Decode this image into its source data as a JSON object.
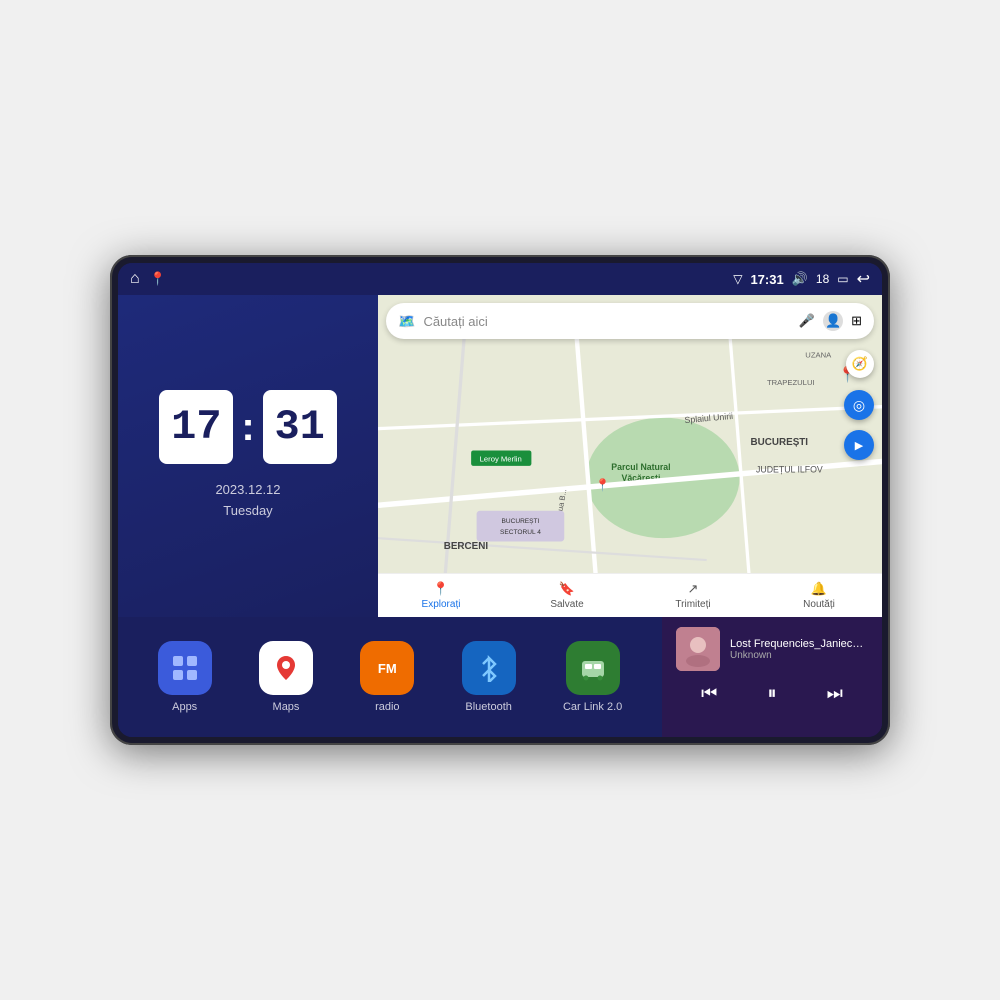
{
  "device": {
    "screen_bg": "#1a1f5e"
  },
  "status_bar": {
    "gps_icon": "▽",
    "time": "17:31",
    "volume_icon": "🔊",
    "battery_level": "18",
    "battery_icon": "▭",
    "back_icon": "↩"
  },
  "nav_icons": [
    {
      "name": "home",
      "symbol": "⌂"
    },
    {
      "name": "map-pin",
      "symbol": "📍"
    }
  ],
  "clock": {
    "hours": "17",
    "minutes": "31",
    "date": "2023.12.12",
    "day": "Tuesday"
  },
  "map": {
    "search_placeholder": "Căutați aici",
    "areas": [
      "BUCUREȘTI",
      "JUDEȚUL ILFOV",
      "BERCENI",
      "TRAPEZULUI",
      "UZANA"
    ],
    "places": [
      "Parcul Natural Văcărești",
      "Leroy Merlin",
      "BUCUREȘTI\nSECTORUL 4"
    ],
    "nav_items": [
      {
        "label": "Explorați",
        "icon": "📍",
        "active": true
      },
      {
        "label": "Salvate",
        "icon": "🔖",
        "active": false
      },
      {
        "label": "Trimiteți",
        "icon": "↗",
        "active": false
      },
      {
        "label": "Noutăți",
        "icon": "🔔",
        "active": false
      }
    ]
  },
  "apps": [
    {
      "name": "Apps",
      "icon": "apps",
      "bg": "#3b5bdb"
    },
    {
      "name": "Maps",
      "icon": "maps",
      "bg": "#e53935"
    },
    {
      "name": "radio",
      "icon": "radio",
      "bg": "#ef6c00"
    },
    {
      "name": "Bluetooth",
      "icon": "bluetooth",
      "bg": "#1565c0"
    },
    {
      "name": "Car Link 2.0",
      "icon": "carlink",
      "bg": "#2e7d32"
    }
  ],
  "music": {
    "title": "Lost Frequencies_Janieck Devy-...",
    "artist": "Unknown",
    "prev_label": "⏮",
    "play_label": "⏸",
    "next_label": "⏭"
  }
}
